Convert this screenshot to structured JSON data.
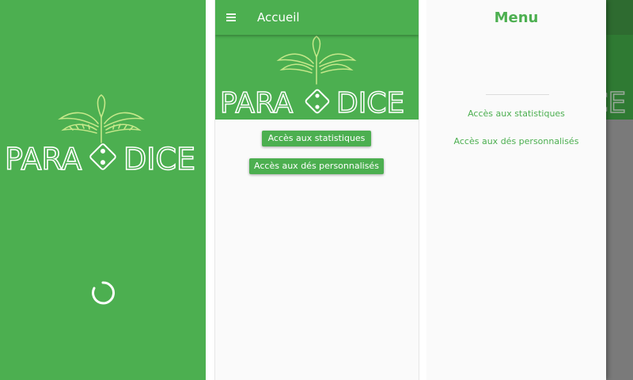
{
  "splash": {
    "logo_text": "PARA DICE",
    "loading_indicator": "spinner"
  },
  "home": {
    "title": "Accueil",
    "menu_icon": "hamburger-menu-icon",
    "banner_logo_text": "PARA DICE",
    "buttons": {
      "stats": "Accès aux statistiques",
      "dice": "Accès aux dés personnalisés"
    }
  },
  "drawer": {
    "title": "Menu",
    "items": [
      {
        "label": "Accès aux statistiques"
      },
      {
        "label": "Accès aux dés personnalisés"
      }
    ]
  },
  "colors": {
    "primary": "#4caf50",
    "logo_green": "#c5e88a",
    "logo_white": "#ffffff",
    "scrim": "#7a7a7a",
    "background": "#fafafa"
  }
}
